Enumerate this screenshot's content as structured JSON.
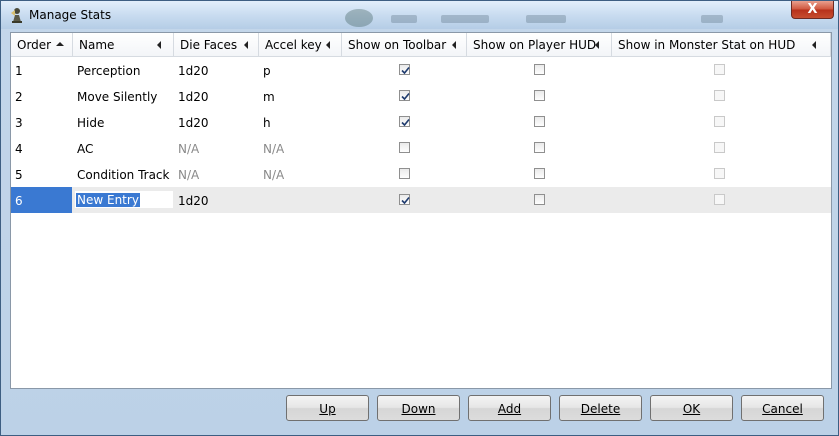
{
  "window": {
    "title": "Manage Stats",
    "close_label": "X",
    "close_color": "#c64d2f"
  },
  "columns": [
    {
      "label": "Order",
      "sort": "ascending"
    },
    {
      "label": "Name"
    },
    {
      "label": "Die Faces"
    },
    {
      "label": "Accel key"
    },
    {
      "label": "Show on Toolbar"
    },
    {
      "label": "Show on Player HUD"
    },
    {
      "label": "Show in Monster Stat on HUD"
    }
  ],
  "rows": [
    {
      "order": "1",
      "name": "Perception",
      "die_faces": "1d20",
      "accel_key": "p",
      "toolbar": true,
      "player_hud": false,
      "monster_hud": false
    },
    {
      "order": "2",
      "name": "Move Silently",
      "die_faces": "1d20",
      "accel_key": "m",
      "toolbar": true,
      "player_hud": false,
      "monster_hud": false
    },
    {
      "order": "3",
      "name": "Hide",
      "die_faces": "1d20",
      "accel_key": "h",
      "toolbar": true,
      "player_hud": false,
      "monster_hud": false
    },
    {
      "order": "4",
      "name": "AC",
      "die_faces": "N/A",
      "accel_key": "N/A",
      "toolbar": false,
      "player_hud": false,
      "monster_hud": false
    },
    {
      "order": "5",
      "name": "Condition Track",
      "die_faces": "N/A",
      "accel_key": "N/A",
      "toolbar": false,
      "player_hud": false,
      "monster_hud": false
    },
    {
      "order": "6",
      "name": "New Entry",
      "die_faces": "1d20",
      "accel_key": "",
      "toolbar": true,
      "player_hud": false,
      "monster_hud": false,
      "selected": true,
      "editing": true
    }
  ],
  "buttons": {
    "up": "Up",
    "down": "Down",
    "add": "Add",
    "delete": "Delete",
    "ok": "OK",
    "cancel": "Cancel"
  },
  "colors": {
    "selection": "#3a79d2",
    "selected_row": "#ebebeb",
    "window_frame": "#bcd1e7"
  }
}
